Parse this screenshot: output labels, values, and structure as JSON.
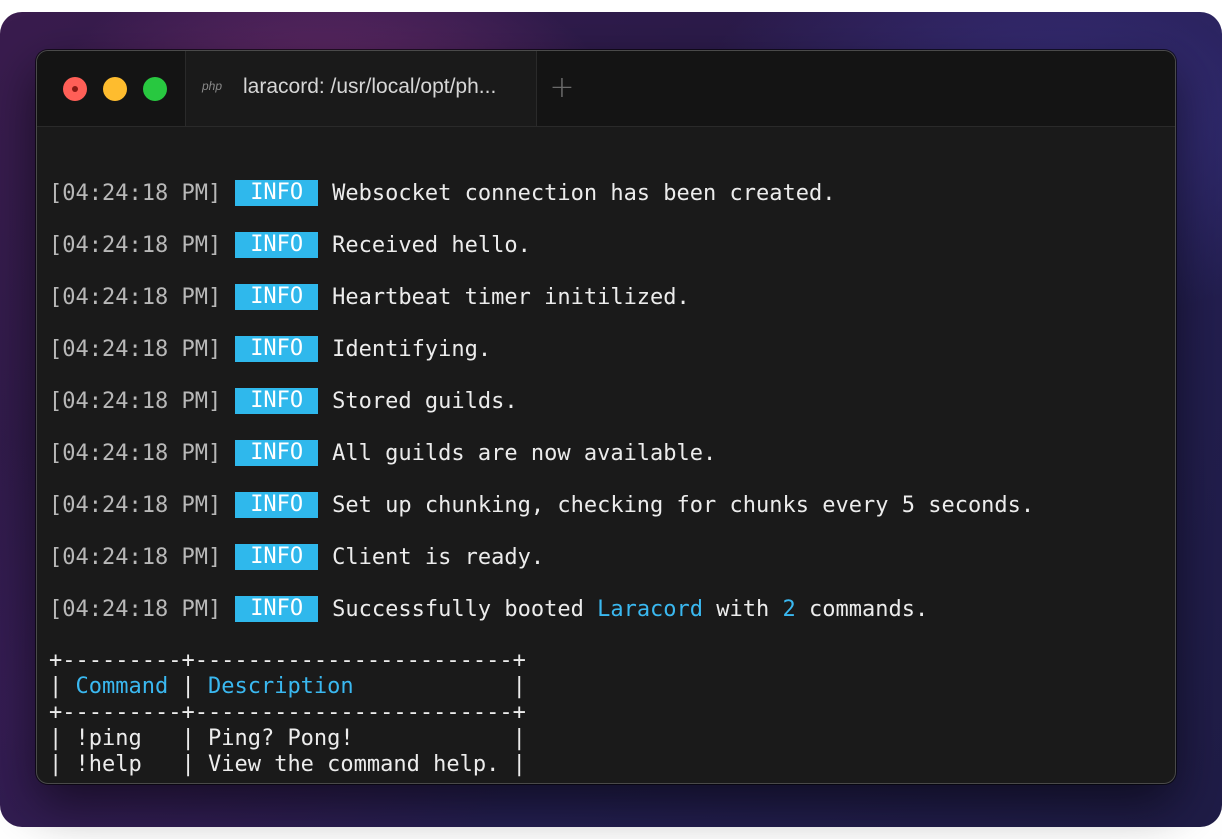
{
  "window": {
    "tab_icon": "php",
    "tab_title": "laracord: /usr/local/opt/ph...",
    "new_tab_label": "+"
  },
  "logs": [
    {
      "time": "[04:24:18 PM]",
      "level": "INFO",
      "message": "Websocket connection has been created."
    },
    {
      "time": "[04:24:18 PM]",
      "level": "INFO",
      "message": "Received hello."
    },
    {
      "time": "[04:24:18 PM]",
      "level": "INFO",
      "message": "Heartbeat timer initilized."
    },
    {
      "time": "[04:24:18 PM]",
      "level": "INFO",
      "message": "Identifying."
    },
    {
      "time": "[04:24:18 PM]",
      "level": "INFO",
      "message": "Stored guilds."
    },
    {
      "time": "[04:24:18 PM]",
      "level": "INFO",
      "message": "All guilds are now available."
    },
    {
      "time": "[04:24:18 PM]",
      "level": "INFO",
      "message": "Set up chunking, checking for chunks every 5 seconds."
    },
    {
      "time": "[04:24:18 PM]",
      "level": "INFO",
      "message": "Client is ready."
    }
  ],
  "boot_line": {
    "time": "[04:24:18 PM]",
    "level": "INFO",
    "prefix": "Successfully booted ",
    "app_name": "Laracord",
    "middle": " with ",
    "count": "2",
    "suffix": " commands."
  },
  "table": {
    "border": "+---------+------------------------+",
    "header_command": "Command",
    "header_description": "Description",
    "rows": [
      {
        "command": "!ping",
        "description": "Ping? Pong!"
      },
      {
        "command": "!help",
        "description": "View the command help."
      }
    ]
  },
  "colors": {
    "info_badge": "#2fb8ec",
    "highlight": "#3ab8f0",
    "terminal_bg": "#1a1a1a",
    "close": "#ff5f57",
    "minimize": "#febc2e",
    "maximize": "#28c840"
  }
}
